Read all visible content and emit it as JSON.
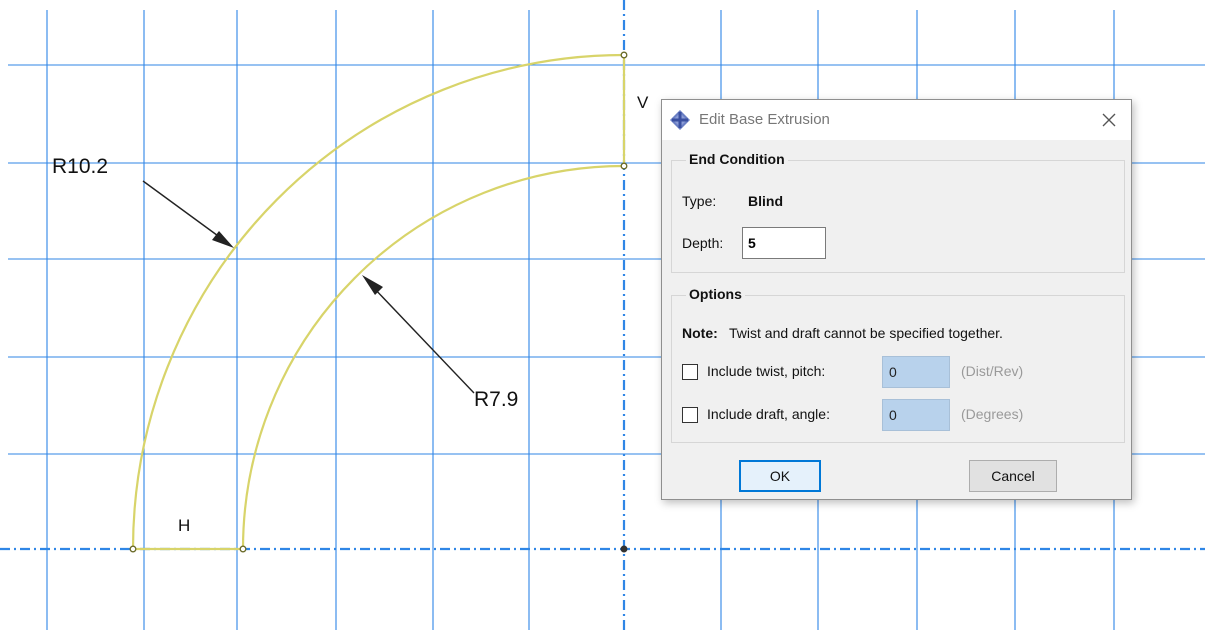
{
  "sketch": {
    "dimension_outer": "R10.2",
    "dimension_inner": "R7.9",
    "constraint_horizontal": "H",
    "constraint_vertical": "V",
    "colors": {
      "grid": "#2f86e6",
      "profile": "#d8d46a",
      "leader": "#222222"
    }
  },
  "dialog": {
    "title": "Edit Base Extrusion",
    "end_condition": {
      "legend": "End Condition",
      "type_label": "Type:",
      "type_value": "Blind",
      "depth_label": "Depth:",
      "depth_value": "5"
    },
    "options": {
      "legend": "Options",
      "note_label": "Note:",
      "note_text": "Twist and draft cannot be specified together.",
      "twist_label": "Include twist, pitch:",
      "twist_value": "0",
      "twist_unit": "(Dist/Rev)",
      "draft_label": "Include draft, angle:",
      "draft_value": "0",
      "draft_unit": "(Degrees)"
    },
    "ok_label": "OK",
    "cancel_label": "Cancel",
    "icons": {
      "app": "abaqus-diamond-icon",
      "close": "close-icon"
    }
  }
}
